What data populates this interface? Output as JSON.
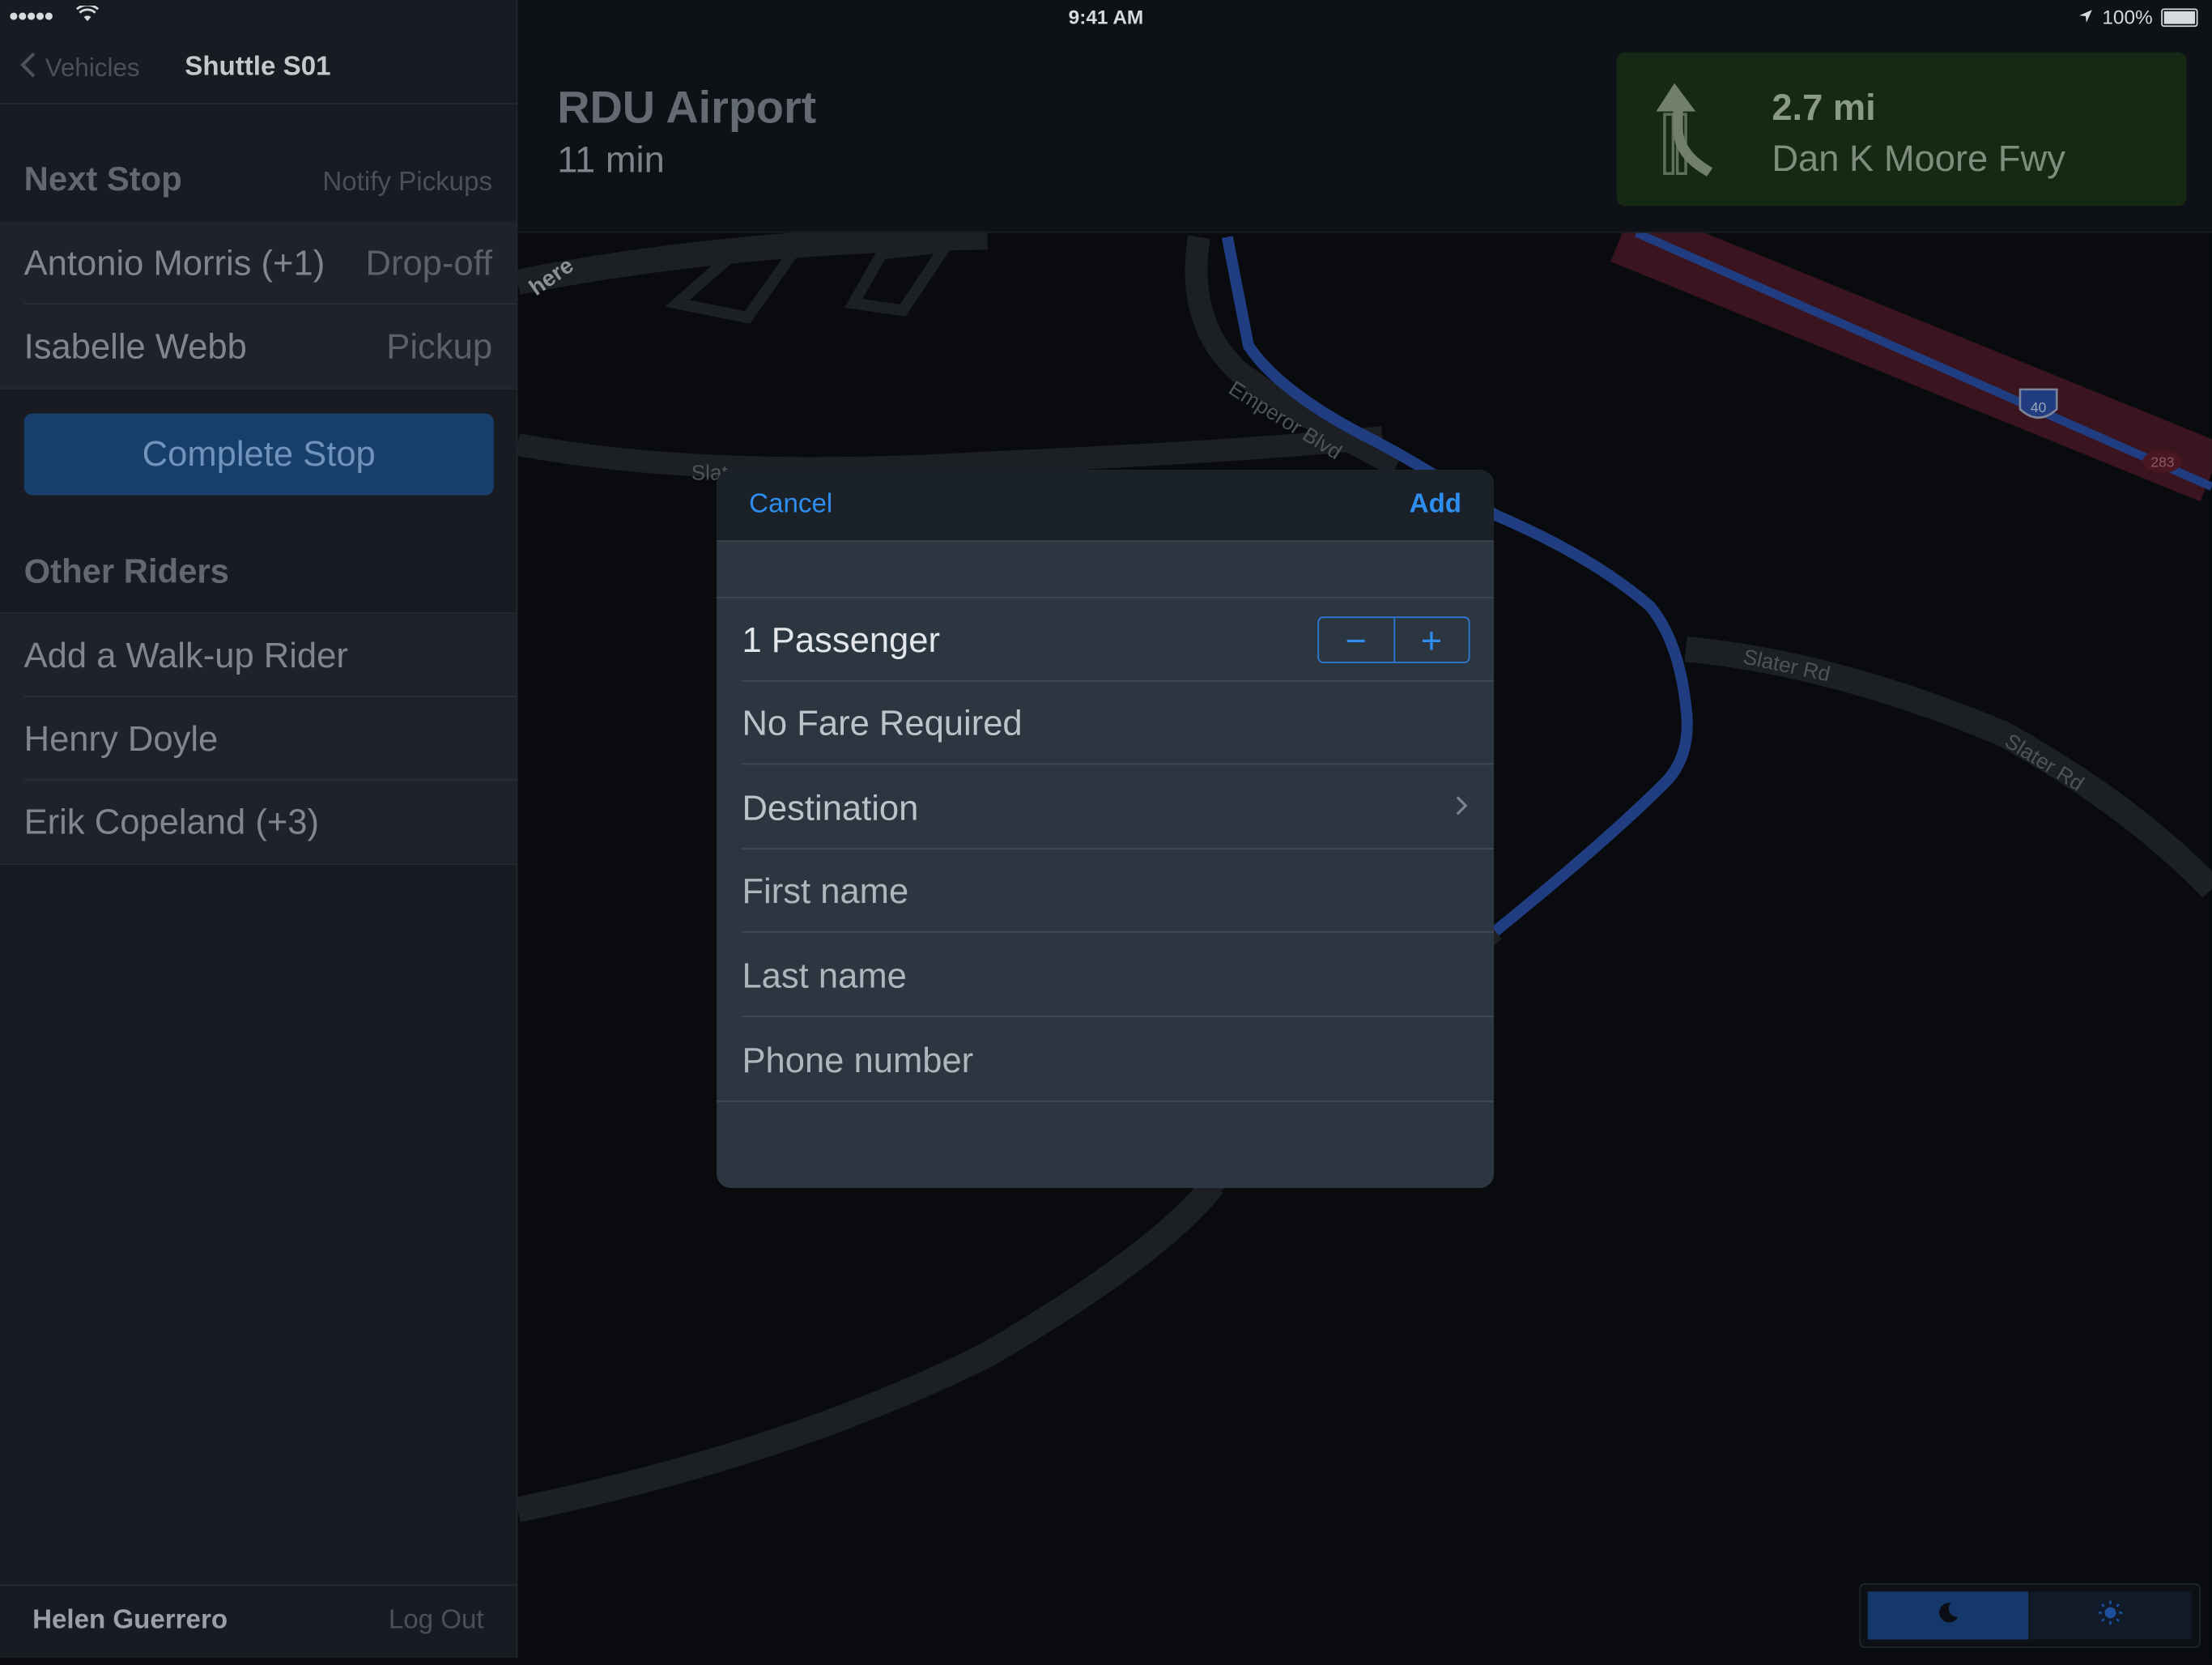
{
  "status": {
    "signal": "●●●●●",
    "time": "9:41 AM",
    "battery": "100%"
  },
  "sidebar": {
    "back_label": "Vehicles",
    "title": "Shuttle S01",
    "next_stop_heading": "Next Stop",
    "notify_label": "Notify Pickups",
    "stops": [
      {
        "name": "Antonio Morris (+1)",
        "type": "Drop-off"
      },
      {
        "name": "Isabelle Webb",
        "type": "Pickup"
      }
    ],
    "complete_label": "Complete Stop",
    "other_heading": "Other Riders",
    "riders": [
      "Add a Walk-up Rider",
      "Henry Doyle",
      "Erik Copeland (+3)"
    ],
    "user_name": "Helen Guerrero",
    "logout_label": "Log Out"
  },
  "header": {
    "destination": "RDU Airport",
    "eta": "11 min",
    "turn_distance": "2.7 mi",
    "turn_road": "Dan K Moore Fwy"
  },
  "map": {
    "labels": [
      "Emperor Blvd",
      "Slater Rd",
      "Slater Rd",
      "Slat",
      "here"
    ],
    "shields": [
      "40",
      "283"
    ],
    "colors": {
      "route": "#1f3d80",
      "highway": "#4a1622",
      "road": "#1c1f24"
    }
  },
  "dialog": {
    "cancel_label": "Cancel",
    "add_label": "Add",
    "passengers_label": "1 Passenger",
    "minus_label": "−",
    "plus_label": "+",
    "fare_label": "No Fare Required",
    "destination_label": "Destination",
    "first_name_placeholder": "First name",
    "last_name_placeholder": "Last name",
    "phone_placeholder": "Phone number"
  },
  "icons": {
    "back": "chevron-left-icon",
    "turn": "turn-left-arrow-icon",
    "night": "moon-icon",
    "day": "sun-icon",
    "chevron": "chevron-right-icon"
  },
  "colors": {
    "accent": "#2e8ef0",
    "complete_button": "#183e6c",
    "turn_panel": "#152914",
    "night_selected": "#15386a"
  }
}
